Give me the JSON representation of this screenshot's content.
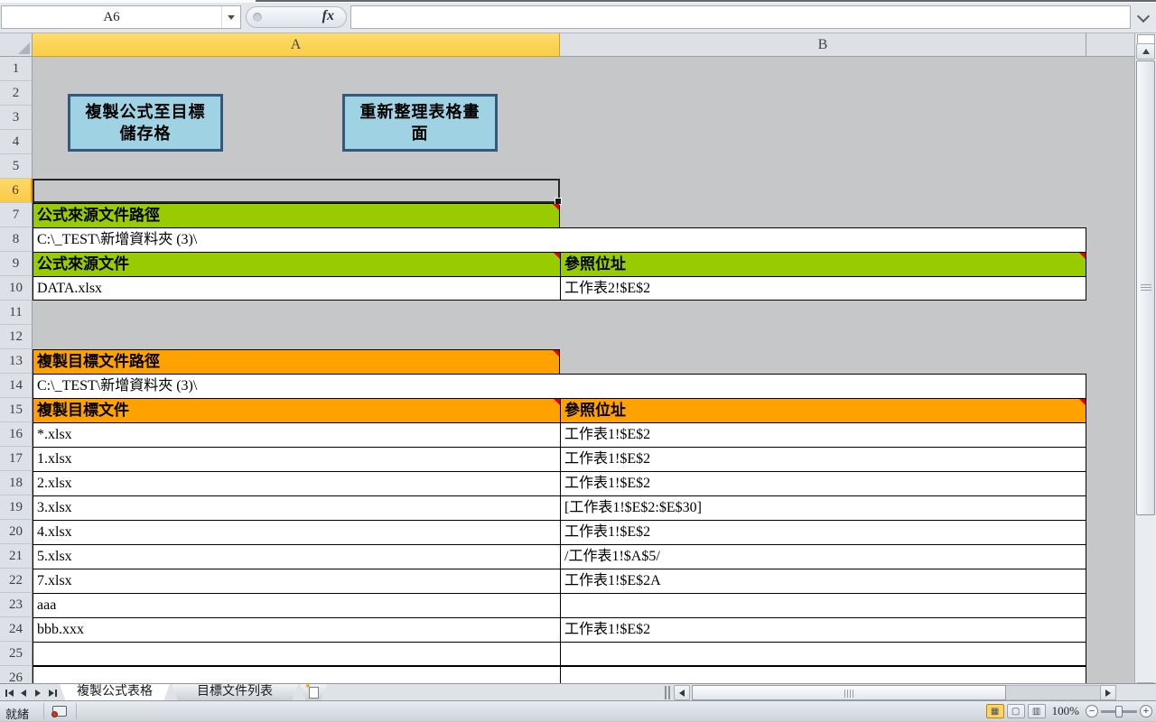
{
  "chrome": {
    "name_box": "A6",
    "fx_label": "fx",
    "formula_value": ""
  },
  "column_headers": {
    "a": "A",
    "b": "B"
  },
  "grid": {
    "row_nums": [
      "1",
      "2",
      "3",
      "4",
      "5",
      "6",
      "7",
      "8",
      "9",
      "10",
      "11",
      "12",
      "13",
      "14",
      "15",
      "16",
      "17",
      "18",
      "19",
      "20",
      "21",
      "22",
      "23",
      "24",
      "25",
      "26"
    ]
  },
  "buttons": {
    "copy": {
      "line1": "複製公式至目標",
      "line2": "儲存格"
    },
    "refresh": {
      "line1": "重新整理表格畫",
      "line2": "面"
    }
  },
  "cells": {
    "a7": "公式來源文件路徑",
    "a8": "C:\\_TEST\\新增資料夾 (3)\\",
    "a9": "公式來源文件",
    "b9": "參照位址",
    "a10": "DATA.xlsx",
    "b10": "工作表2!$E$2",
    "a13": "複製目標文件路徑",
    "a14": "C:\\_TEST\\新增資料夾 (3)\\",
    "a15": "複製目標文件",
    "b15": "參照位址",
    "a16": "*.xlsx",
    "b16": "工作表1!$E$2",
    "a17": "1.xlsx",
    "b17": "工作表1!$E$2",
    "a18": "2.xlsx",
    "b18": "工作表1!$E$2",
    "a19": "3.xlsx",
    "b19": "[工作表1!$E$2:$E$30]",
    "a20": "4.xlsx",
    "b20": "工作表1!$E$2",
    "a21": "5.xlsx",
    "b21": "/工作表1!$A$5/",
    "a22": "7.xlsx",
    "b22": "工作表1!$E$2A",
    "a23": "aaa",
    "a24": "bbb.xxx",
    "b24": "工作表1!$E$2"
  },
  "tabs": {
    "active": "複製公式表格",
    "inactive": "目標文件列表"
  },
  "status": {
    "ready": "就緒",
    "zoom": "100%"
  },
  "colors": {
    "section_green": "#99CC00",
    "section_orange": "#FFA200",
    "button_fill": "#9FD3E3",
    "button_border": "#33597F",
    "selected_header": "#FBCF47",
    "comment_indicator": "#E30000"
  }
}
